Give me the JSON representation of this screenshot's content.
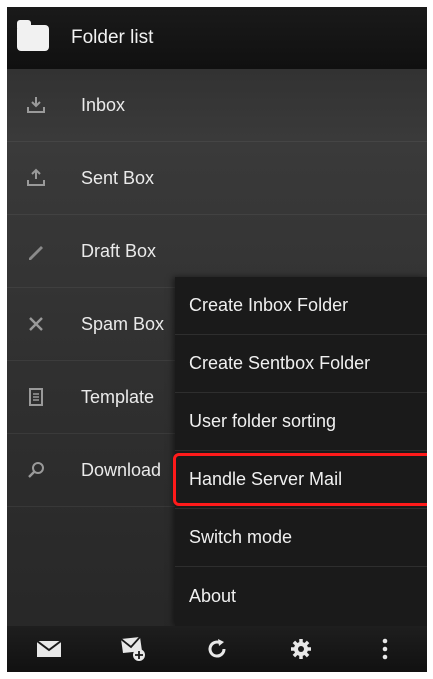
{
  "titlebar": {
    "title": "Folder list",
    "icon": "folder-icon"
  },
  "folders": [
    {
      "label": "Inbox",
      "icon": "inbox-icon"
    },
    {
      "label": "Sent Box",
      "icon": "sent-box-icon"
    },
    {
      "label": "Draft Box",
      "icon": "draft-icon"
    },
    {
      "label": "Spam Box",
      "icon": "spam-icon"
    },
    {
      "label": "Template",
      "icon": "template-icon"
    },
    {
      "label": "Download",
      "icon": "download-search-icon"
    }
  ],
  "menu": [
    {
      "label": "Create Inbox Folder"
    },
    {
      "label": "Create Sentbox Folder"
    },
    {
      "label": "User folder sorting"
    },
    {
      "label": "Handle Server Mail",
      "highlighted": true
    },
    {
      "label": "Switch mode"
    },
    {
      "label": "About"
    }
  ],
  "bottombar": [
    {
      "icon": "envelope-icon"
    },
    {
      "icon": "compose-mail-icon"
    },
    {
      "icon": "refresh-icon"
    },
    {
      "icon": "settings-gear-icon"
    },
    {
      "icon": "more-options-icon"
    }
  ],
  "colors": {
    "highlight_border": "#ff1a1a",
    "menu_bg": "#1a1a1a"
  }
}
